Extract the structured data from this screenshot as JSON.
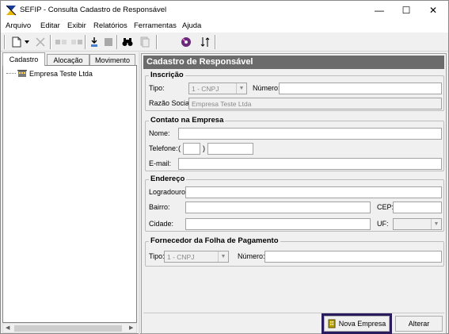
{
  "window": {
    "title": "SEFIP - Consulta Cadastro de Responsável",
    "controls": {
      "minimize": "—",
      "maximize": "☐",
      "close": "✕"
    }
  },
  "menu": {
    "items": [
      {
        "label": "Arquivo"
      },
      {
        "label": "Editar"
      },
      {
        "label": "Exibir"
      },
      {
        "label": "Relatórios"
      },
      {
        "label": "Ferramentas"
      },
      {
        "label": "Ajuda"
      }
    ]
  },
  "toolbar": {
    "icons": [
      "new-icon",
      "dropdown-icon",
      "delete-icon",
      "move-left-icon",
      "move-right-icon",
      "import-icon",
      "stop-icon",
      "binoculars-icon",
      "copy-icon",
      "disk-icon",
      "sort-icon"
    ]
  },
  "left_panel": {
    "tabs": [
      {
        "label": "Cadastro",
        "active": true
      },
      {
        "label": "Alocação",
        "active": false
      },
      {
        "label": "Movimento",
        "active": false
      }
    ],
    "tree": [
      {
        "label": "Empresa Teste Ltda",
        "icon": "building-icon"
      }
    ]
  },
  "form": {
    "header": "Cadastro de Responsável",
    "inscricao": {
      "title": "Inscrição",
      "tipo_label": "Tipo:",
      "tipo_value": "1 - CNPJ",
      "numero_label": "Número:",
      "numero_value": "",
      "razao_label": "Razão Social:",
      "razao_value": "Empresa Teste Ltda"
    },
    "contato": {
      "title": "Contato na Empresa",
      "nome_label": "Nome:",
      "telefone_label": "Telefone:",
      "paren_open": "(",
      "paren_close": ")",
      "email_label": "E-mail:"
    },
    "endereco": {
      "title": "Endereço",
      "logradouro_label": "Logradouro:",
      "bairro_label": "Bairro:",
      "cep_label": "CEP:",
      "cidade_label": "Cidade:",
      "uf_label": "UF:"
    },
    "fornecedor": {
      "title": "Fornecedor da Folha de Pagamento",
      "tipo_label": "Tipo:",
      "tipo_value": "1 - CNPJ",
      "numero_label": "Número:"
    }
  },
  "buttons": {
    "nova_empresa": "Nova Empresa",
    "alterar": "Alterar"
  },
  "colors": {
    "header_bg": "#6b6b6b",
    "highlight_outline": "#2a1a5e"
  }
}
